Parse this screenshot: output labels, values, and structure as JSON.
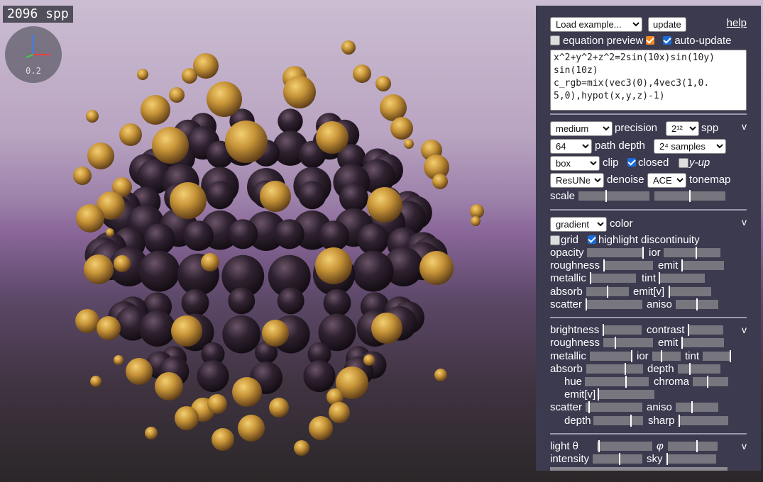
{
  "overlay": {
    "spp": "2096 spp",
    "gizmo_value": "0.2"
  },
  "editor": {
    "example_select": "Load example...",
    "update_label": "update",
    "help_label": "help",
    "equation_preview_label": "equation preview",
    "auto_update_label": "auto-update",
    "equation": "x^2+y^2+z^2=2sin(10x)sin(10y)\nsin(10z)\nc_rgb=mix(vec3(0),4vec3(1,0.\n5,0),hypot(x,y,z)-1)"
  },
  "render": {
    "precision_select": "medium",
    "precision_label": "precision",
    "spp_select": "2¹²",
    "spp_label": "spp",
    "depth_select": "64",
    "depth_label": "path depth",
    "samples_select": "2⁴ samples",
    "clip_select": "box",
    "clip_label": "clip",
    "closed_label": "closed",
    "yup_label": "y-up",
    "denoise_select": "ResUNet",
    "denoise_label": "denoise",
    "tonemap_select": "ACES",
    "tonemap_label": "tonemap",
    "scale_label": "scale",
    "caret": "v"
  },
  "material": {
    "color_select": "gradient",
    "color_label": "color",
    "grid_label": "grid",
    "highlight_label": "highlight discontinuity",
    "opacity": "opacity",
    "ior": "ior",
    "roughness": "roughness",
    "emit": "emit",
    "metallic": "metallic",
    "tint": "tint",
    "absorb": "absorb",
    "emitv": "emit[v]",
    "scatter": "scatter",
    "aniso": "aniso",
    "caret": "v"
  },
  "post": {
    "brightness": "brightness",
    "contrast": "contrast",
    "roughness": "roughness",
    "emit": "emit",
    "metallic": "metallic",
    "ior": "ior",
    "tint": "tint",
    "absorb": "absorb",
    "depth": "depth",
    "hue": "hue",
    "chroma": "chroma",
    "emitv": "emit[v]",
    "scatter": "scatter",
    "aniso": "aniso",
    "depth2": "depth",
    "sharp": "sharp",
    "caret": "v"
  },
  "lighting": {
    "theta": "light θ",
    "phi": "φ",
    "intensity": "intensity",
    "sky": "sky",
    "caret": "v"
  },
  "colors": {
    "panel": "#3b3a4f",
    "accent_check": "#1a6cd8",
    "orange_check": "#f08a20",
    "ball_gold": "#c89538",
    "ball_dark": "#2f2230"
  }
}
